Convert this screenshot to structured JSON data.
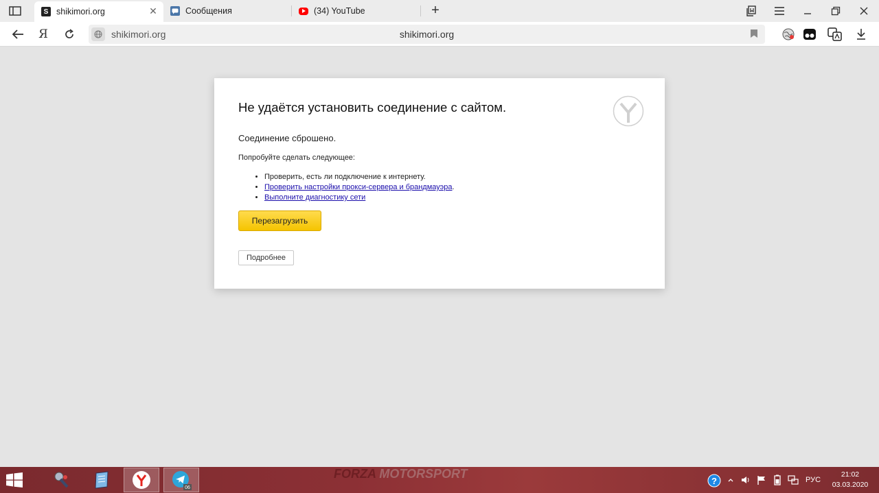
{
  "tabs": [
    {
      "title": "shikimori.org",
      "favicon": "S",
      "favicon_color": "#222222",
      "active": true
    },
    {
      "title": "Сообщения",
      "favicon": "vk-icon",
      "favicon_color": "#4a76a8",
      "active": false
    },
    {
      "title": "(34) YouTube",
      "favicon": "youtube-icon",
      "favicon_color": "#ff0000",
      "active": false
    }
  ],
  "toolbar": {
    "yandex_logo": "Я",
    "domain": "shikimori.org",
    "page_title": "shikimori.org"
  },
  "error": {
    "title": "Не удаётся установить соединение с сайтом.",
    "subtitle": "Соединение сброшено.",
    "try_text": "Попробуйте сделать следующее:",
    "items": [
      {
        "text": "Проверить, есть ли подключение к интернету.",
        "link": false
      },
      {
        "text": "Проверить настройки прокси-сервера и брандмауэра",
        "link": true,
        "suffix": "."
      },
      {
        "text": "Выполните диагностику сети",
        "link": true,
        "suffix": ""
      }
    ],
    "reload_label": "Перезагрузить",
    "details_label": "Подробнее"
  },
  "taskbar": {
    "wallpaper_text_a": "FORZA ",
    "wallpaper_text_b": "MOTORSPORT",
    "telegram_badge": "06",
    "lang": "РУС",
    "time": "21:02",
    "date": "03.03.2020"
  },
  "colors": {
    "accent_button": "#f5c400",
    "link": "#1a0dab",
    "taskbar": "#8c3035"
  }
}
